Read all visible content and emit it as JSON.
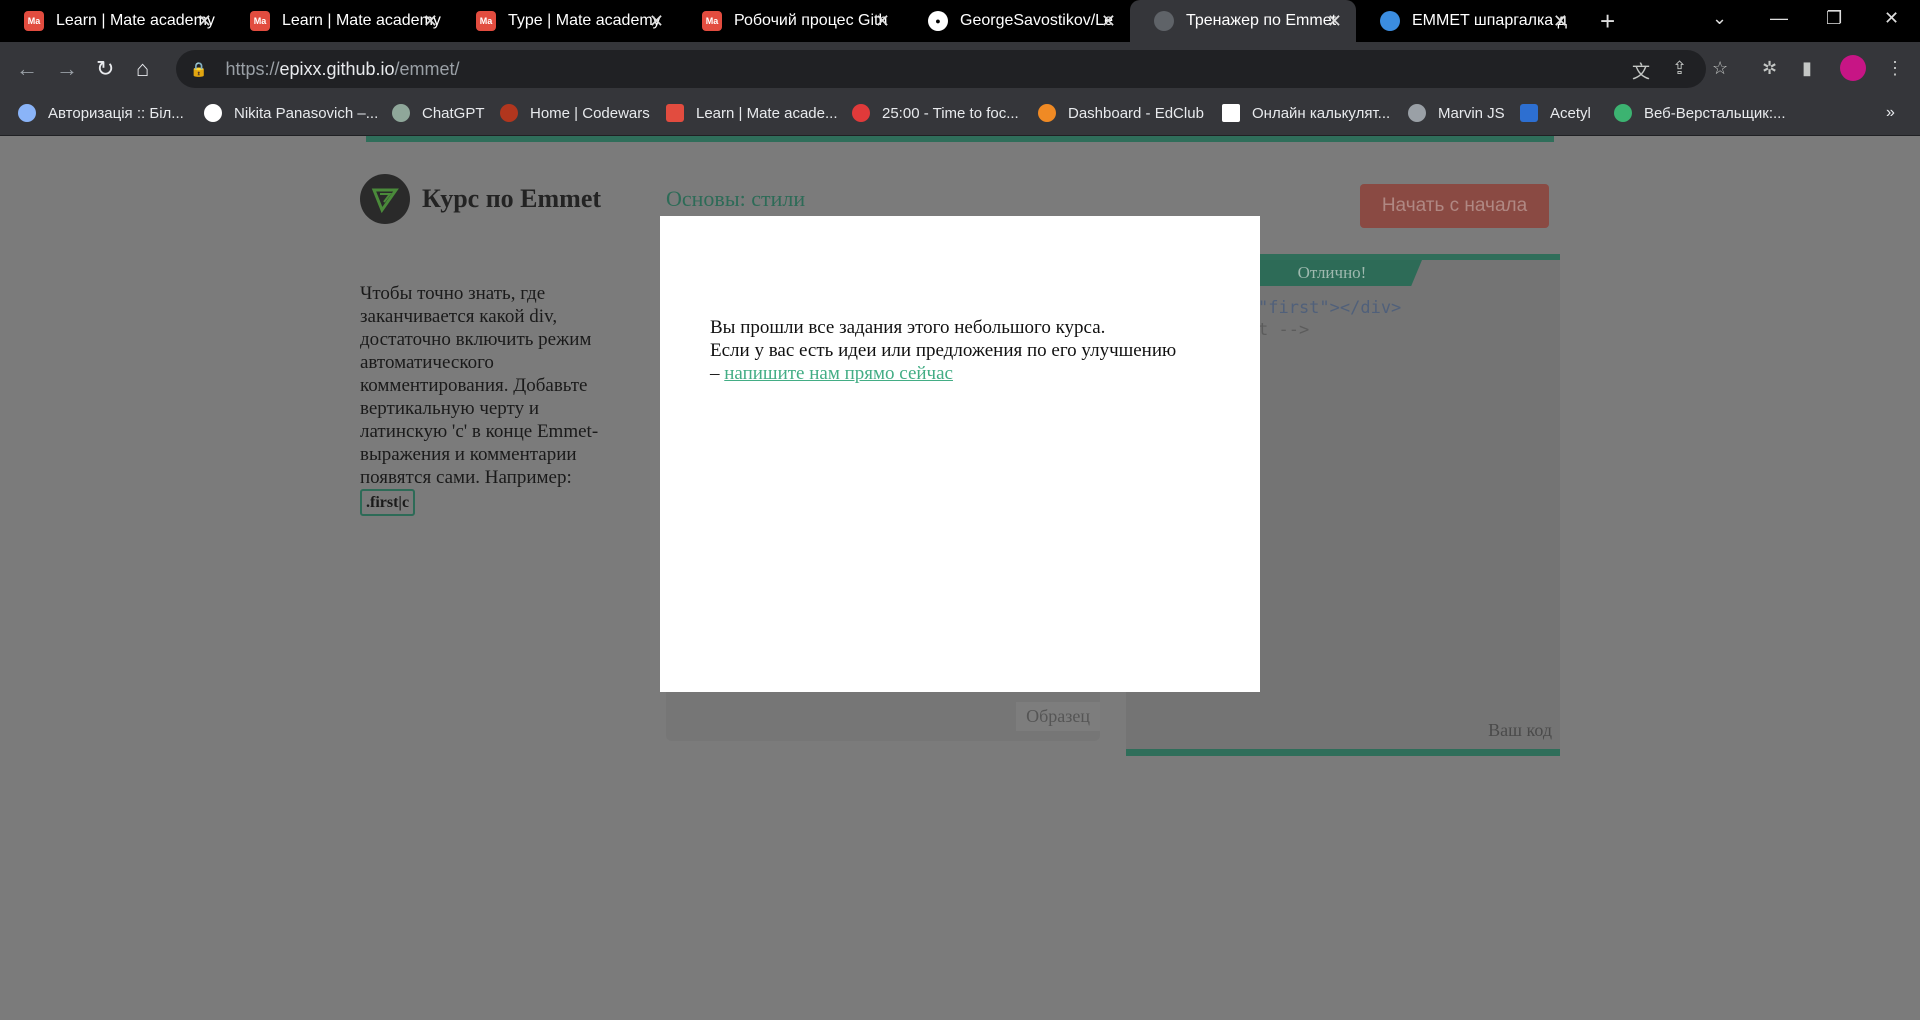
{
  "browser": {
    "tabs": [
      {
        "favicon": "Ma",
        "title": "Learn | Mate academy"
      },
      {
        "favicon": "Ma",
        "title": "Learn | Mate academy"
      },
      {
        "favicon": "Ma",
        "title": "Type | Mate academy"
      },
      {
        "favicon": "Ma",
        "title": "Робочий процес Gith"
      },
      {
        "favicon": "github-icon",
        "title": "GeorgeSavostikov/Le"
      },
      {
        "favicon": "globe-icon",
        "title": "Тренажер по Emmet"
      },
      {
        "favicon": "globe-icon",
        "title": "EMMET шпаргалка д"
      }
    ],
    "url_prefix": "https://",
    "url_host": "epixx.github.io",
    "url_path": "/emmet/",
    "bookmarks": [
      "Авторизація :: Біл...",
      "Nikita Panasovich –...",
      "ChatGPT",
      "Home | Codewars",
      "Learn | Mate acade...",
      "25:00 - Time to foc...",
      "Dashboard - EdClub",
      "Онлайн калькулят...",
      "Marvin JS",
      "Acetyl",
      "Веб-Верстальщик:..."
    ]
  },
  "page": {
    "course_title": "Курс по Emmet",
    "lesson_title": "Основы: стили",
    "restart_label": "Начать с начала",
    "description": "Чтобы точно знать, где заканчивается какой div, достаточно включить режим автоматического комментирования. Добавьте вертикальную черту и латинскую 'c' в конце Emmet-выражения и комментарии появятся сами. Например:",
    "code_example": ".first|c",
    "success_label": "Отлично!",
    "code_line1": "\"first\"></div>",
    "code_line2": "t -->",
    "sample_label": "Образец",
    "yours_label": "Ваш код"
  },
  "modal": {
    "line1": "Вы прошли все задания этого небольшого курса.",
    "line2": "Если у вас есть идеи или предложения по его улучшению",
    "dash": "– ",
    "link_text": "напишите нам прямо сейчас"
  }
}
